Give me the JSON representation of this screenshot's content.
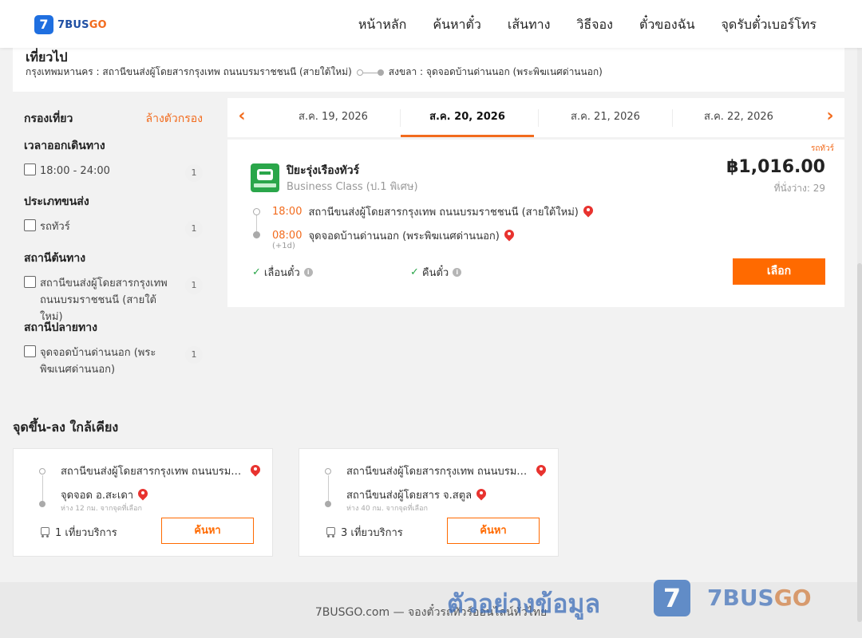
{
  "header": {
    "logo_glyph": "7",
    "logo_text_a": "7BUS",
    "logo_text_b": "GO",
    "nav": [
      "หน้าหลัก",
      "ค้นหาตั๋ว",
      "เส้นทาง",
      "วิธีจอง",
      "ตั๋วของฉัน",
      "จุดรับตั๋วเบอร์โทร"
    ]
  },
  "trip": {
    "title": "เที่ยวไป",
    "from": "กรุงเทพมหานคร : สถานีขนส่งผู้โดยสารกรุงเทพ ถนนบรมราชชนนี (สายใต้ใหม่)",
    "to": "สงขลา : จุดจอดบ้านด่านนอก (พระพิฆเนศด่านนอก)"
  },
  "filter": {
    "title": "กรองเที่ยว",
    "clear": "ล้างตัวกรอง",
    "groups": [
      {
        "title": "เวลาออกเดินทาง",
        "options": [
          {
            "label": "18:00 - 24:00",
            "count": "1"
          }
        ]
      },
      {
        "title": "ประเภทขนส่ง",
        "options": [
          {
            "label": "รถทัวร์",
            "count": "1"
          }
        ]
      },
      {
        "title": "สถานีต้นทาง",
        "options": [
          {
            "label": "สถานีขนส่งผู้โดยสารกรุงเทพ ถนนบรมราชชนนี (สายใต้ใหม่)",
            "count": "1"
          }
        ]
      },
      {
        "title": "สถานีปลายทาง",
        "options": [
          {
            "label": "จุดจอดบ้านด่านนอก (พระพิฆเนศด่านนอก)",
            "count": "1"
          }
        ]
      }
    ]
  },
  "dates": {
    "tabs": [
      "ส.ค. 19, 2026",
      "ส.ค. 20, 2026",
      "ส.ค. 21, 2026",
      "ส.ค. 22, 2026"
    ],
    "active_index": 1,
    "arrow_left": "‹",
    "arrow_right": "›"
  },
  "result": {
    "tag": "รถทัวร์",
    "operator": "ปิยะรุ่งเรืองทัวร์",
    "class": "Business Class (ป.1 พิเศษ)",
    "price": "฿1,016.00",
    "seats": "ที่นั่งว่าง: 29",
    "depart_time": "18:00",
    "depart_station": "สถานีขนส่งผู้โดยสารกรุงเทพ ถนนบรมราชชนนี (สายใต้ใหม่)",
    "arrive_time": "08:00",
    "arrive_station": "จุดจอดบ้านด่านนอก (พระพิฆเนศด่านนอก)",
    "plus_day": "(+1d)",
    "feature_1": "เลื่อนตั๋ว",
    "feature_2": "คืนตั๋ว",
    "select_label": "เลือก"
  },
  "nearby": {
    "title": "จุดขึ้น-ลง ใกล้เคียง",
    "cards": [
      {
        "from": "สถานีขนส่งผู้โดยสารกรุงเทพ ถนนบรมราชชนนี (สายใต้ใหม่)",
        "to": "จุดจอด อ.สะเดา",
        "distance": "ห่าง 12 กม. จากจุดที่เลือก",
        "trips": "1 เที่ยวบริการ",
        "button": "ค้นหา"
      },
      {
        "from": "สถานีขนส่งผู้โดยสารกรุงเทพ ถนนบรมราชชนนี (สายใต้ใหม่)",
        "to": "สถานีขนส่งผู้โดยสาร จ.สตูล",
        "distance": "ห่าง 40 กม. จากจุดที่เลือก",
        "trips": "3 เที่ยวบริการ",
        "button": "ค้นหา"
      }
    ]
  },
  "footer": {
    "text": "7BUSGO.com — จองตั๋วรถทัวร์ออนไลน์ทั่วไทย",
    "watermark_text": "ตัวอย่างข้อมูล",
    "watermark_logo": "7",
    "watermark_brand_a": "7BUS",
    "watermark_brand_b": "GO"
  },
  "colors": {
    "accent": "#ff6a00",
    "brand_blue": "#1f6fe0",
    "pin": "#e8332f",
    "check": "#2aa64a"
  }
}
